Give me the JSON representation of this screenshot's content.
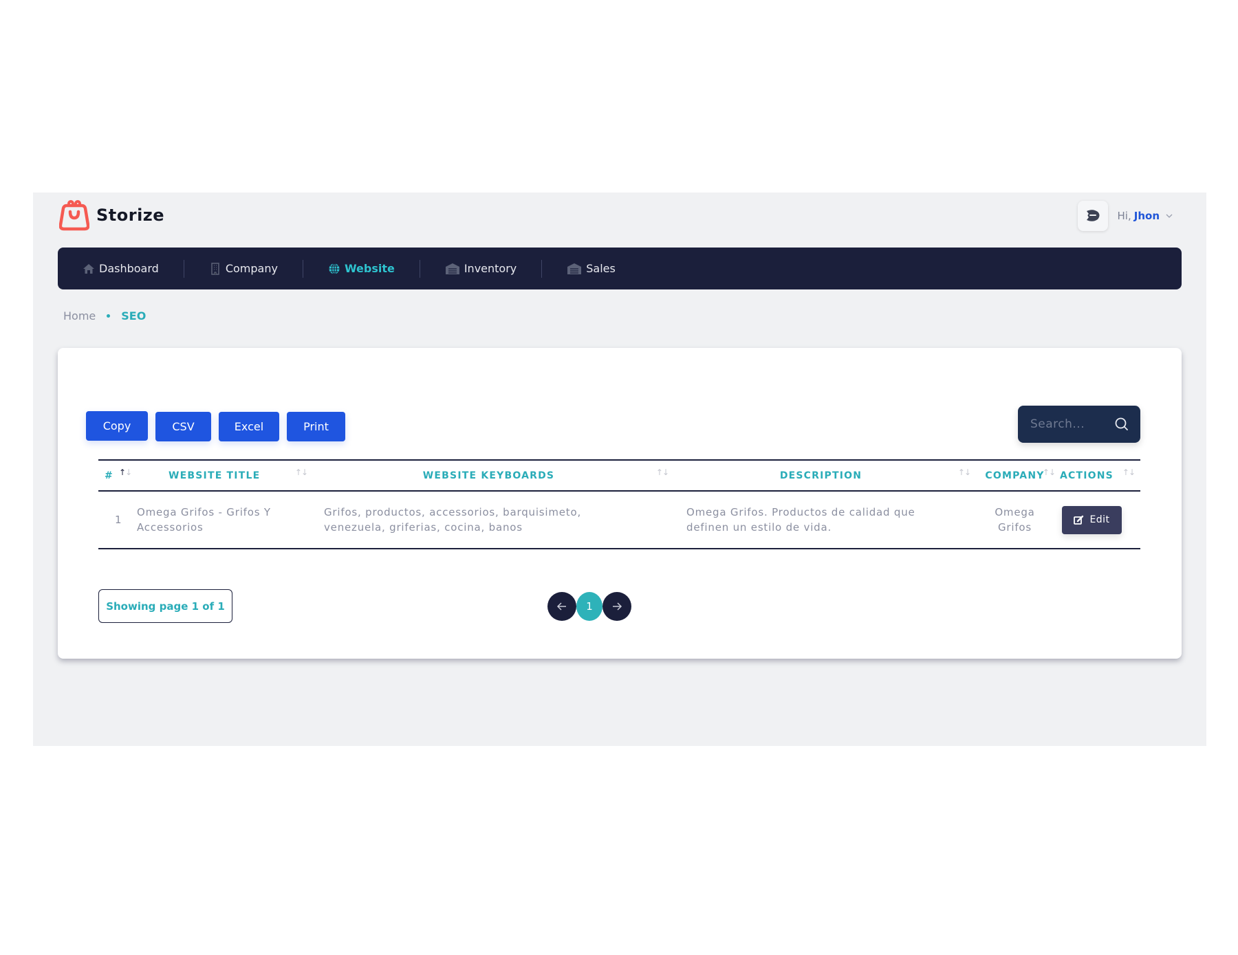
{
  "brand": {
    "name": "Storize",
    "logo_color": "#f55a52"
  },
  "user": {
    "greeting": "Hi,",
    "name": "Jhon"
  },
  "nav": {
    "items": [
      {
        "label": "Dashboard",
        "icon": "home-icon",
        "active": false
      },
      {
        "label": "Company",
        "icon": "building-icon",
        "active": false
      },
      {
        "label": "Website",
        "icon": "globe-icon",
        "active": true
      },
      {
        "label": "Inventory",
        "icon": "warehouse-icon",
        "active": false
      },
      {
        "label": "Sales",
        "icon": "warehouse-icon",
        "active": false
      }
    ]
  },
  "breadcrumb": {
    "home": "Home",
    "current": "SEO"
  },
  "toolbar": {
    "copy_label": "Copy",
    "csv_label": "CSV",
    "excel_label": "Excel",
    "print_label": "Print",
    "search_placeholder": "Search..."
  },
  "table": {
    "columns": [
      "#",
      "WEBSITE TITLE",
      "WEBSITE KEYBOARDS",
      "DESCRIPTION",
      "COMPANY",
      "ACTIONS"
    ],
    "rows": [
      {
        "index": "1",
        "website_title": "Omega Grifos - Grifos Y Accessorios",
        "website_keywords": "Grifos, productos, accessorios, barquisimeto, venezuela, griferias, cocina, banos",
        "description": "Omega Grifos. Productos de calidad que definen un estilo de vida.",
        "company": "Omega Grifos",
        "action_label": "Edit"
      }
    ]
  },
  "pagination": {
    "info": "Showing page 1 of 1",
    "current_page": "1"
  },
  "colors": {
    "accent": "#2aacb8",
    "primary_button": "#1f55e0",
    "nav_bg": "#1b1f3b",
    "search_bg": "#1c2d4d",
    "edit_button": "#3a3d5e"
  }
}
